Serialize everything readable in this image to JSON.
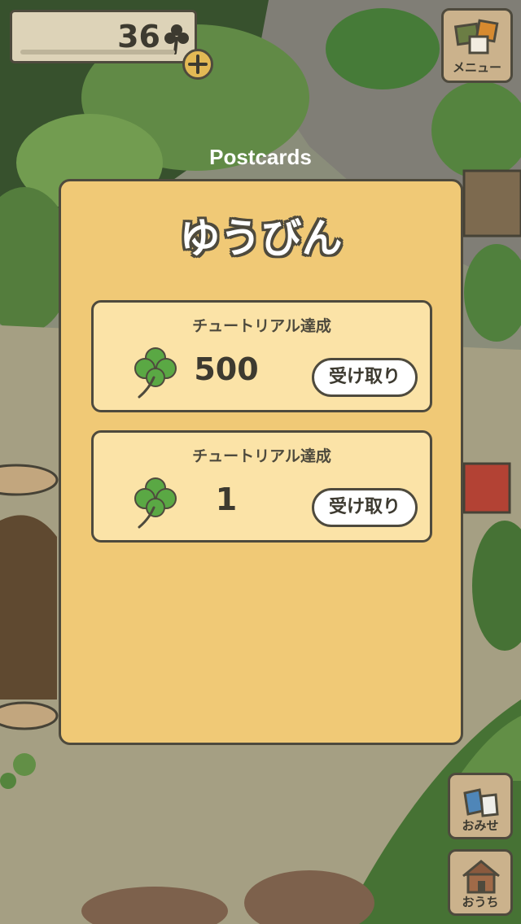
{
  "header": {
    "clover_count": "36",
    "clover_icon": "clover-icon",
    "add_icon": "plus-icon"
  },
  "menu": {
    "label": "メニュー",
    "icon": "postcards-stack-icon"
  },
  "overlay": {
    "title": "Postcards"
  },
  "panel": {
    "heading": "ゆうびん",
    "items": [
      {
        "title": "チュートリアル達成",
        "reward_icon": "four-leaf-clover-icon",
        "amount": "500",
        "button_label": "受け取り"
      },
      {
        "title": "チュートリアル達成",
        "reward_icon": "four-leaf-clover-icon",
        "amount": "1",
        "button_label": "受け取り"
      }
    ]
  },
  "bottom_nav": {
    "shop_label": "おみせ",
    "shop_icon": "shop-bags-icon",
    "home_label": "おうち",
    "home_icon": "house-icon"
  },
  "colors": {
    "panel_bg": "#f0c976",
    "card_bg": "#fbe3a7",
    "outline": "#4e4a3d",
    "clover_green": "#5aa844"
  }
}
